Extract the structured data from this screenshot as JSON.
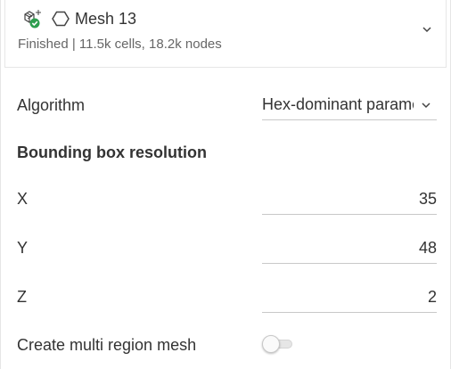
{
  "header": {
    "title": "Mesh 13",
    "status": "Finished | 11.5k cells, 18.2k nodes",
    "mesh_icon": "mesh-cube-check-icon",
    "shape_icon": "hexagon-icon",
    "expand_icon": "chevron-down-icon"
  },
  "algorithm": {
    "label": "Algorithm",
    "value": "Hex-dominant parametric"
  },
  "bounding_box": {
    "title": "Bounding box resolution",
    "x_label": "X",
    "x_value": "35",
    "y_label": "Y",
    "y_value": "48",
    "z_label": "Z",
    "z_value": "2"
  },
  "multi_region": {
    "label": "Create multi region mesh",
    "enabled": false
  },
  "colors": {
    "success_green": "#2e9e4f",
    "text": "#333333",
    "muted": "#666666",
    "border": "#e6e6e6"
  }
}
